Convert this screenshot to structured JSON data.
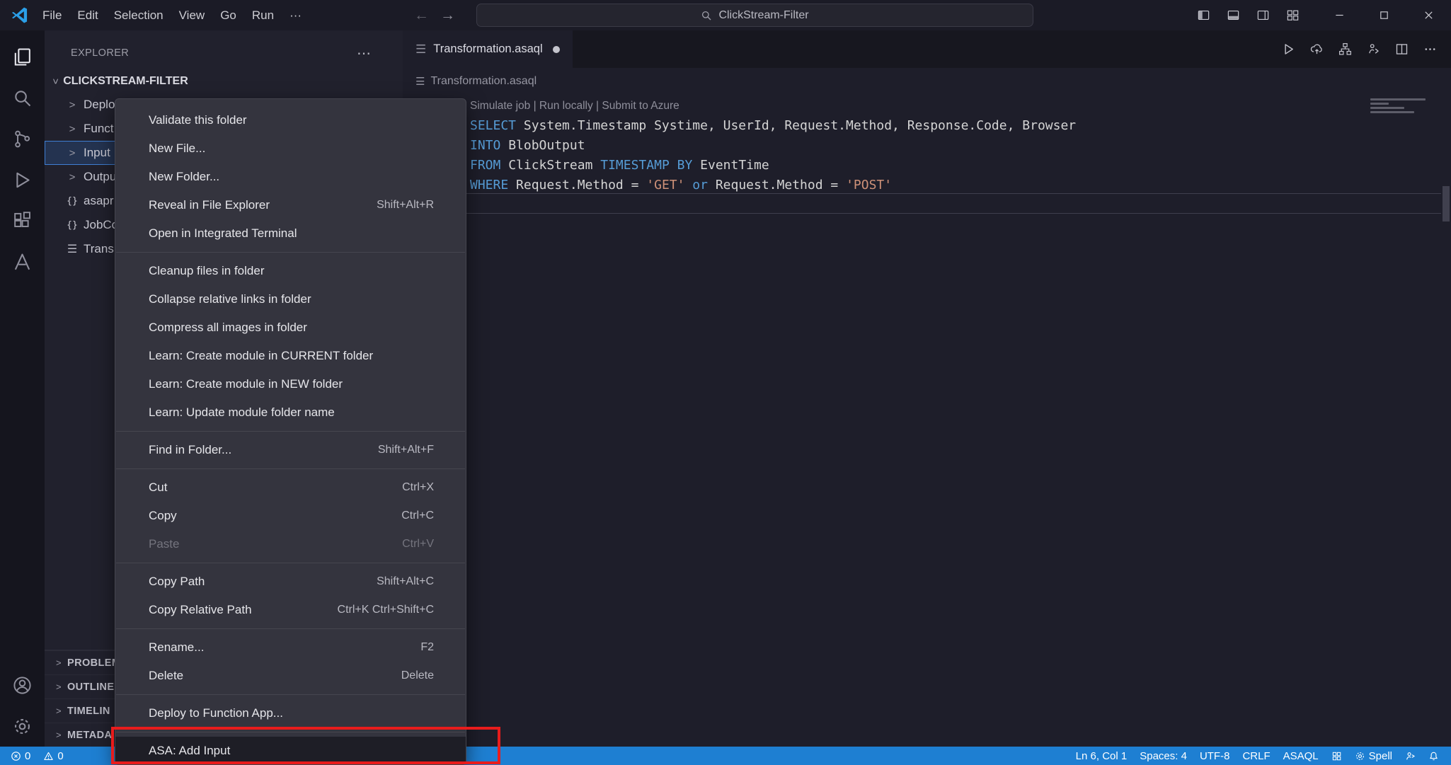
{
  "colors": {
    "statusbar_bg": "#1e7fd2",
    "annotation": "#e81c1c",
    "keyword": "#569cd6",
    "string": "#ce9178",
    "plain": "#d4d4d4",
    "codelens": "#8f8f9b"
  },
  "title_bar": {
    "menus": [
      "File",
      "Edit",
      "Selection",
      "View",
      "Go",
      "Run",
      "···"
    ],
    "search_text": "ClickStream-Filter"
  },
  "explorer": {
    "title": "EXPLORER",
    "root_label": "CLICKSTREAM-FILTER",
    "items": [
      {
        "label": "Deplo",
        "icon": "chevron",
        "selected": false
      },
      {
        "label": "Funct",
        "icon": "chevron",
        "selected": false
      },
      {
        "label": "Input",
        "icon": "chevron",
        "selected": true
      },
      {
        "label": "Outpu",
        "icon": "chevron",
        "selected": false
      },
      {
        "label": "asapr",
        "icon": "json",
        "selected": false
      },
      {
        "label": "JobCo",
        "icon": "json",
        "selected": false
      },
      {
        "label": "Trans",
        "icon": "file",
        "selected": false
      }
    ],
    "bottom_sections": [
      "PROBLEM",
      "OUTLINE",
      "TIMELIN",
      "METADA"
    ]
  },
  "context_menu": {
    "groups": [
      {
        "items": [
          {
            "label": "Validate this folder"
          },
          {
            "label": "New File..."
          },
          {
            "label": "New Folder..."
          },
          {
            "label": "Reveal in File Explorer",
            "shortcut": "Shift+Alt+R"
          },
          {
            "label": "Open in Integrated Terminal"
          }
        ]
      },
      {
        "items": [
          {
            "label": "Cleanup files in folder"
          },
          {
            "label": "Collapse relative links in folder"
          },
          {
            "label": "Compress all images in folder"
          },
          {
            "label": "Learn: Create module in CURRENT folder"
          },
          {
            "label": "Learn: Create module in NEW folder"
          },
          {
            "label": "Learn: Update module folder name"
          }
        ]
      },
      {
        "items": [
          {
            "label": "Find in Folder...",
            "shortcut": "Shift+Alt+F"
          }
        ]
      },
      {
        "items": [
          {
            "label": "Cut",
            "shortcut": "Ctrl+X"
          },
          {
            "label": "Copy",
            "shortcut": "Ctrl+C"
          },
          {
            "label": "Paste",
            "shortcut": "Ctrl+V",
            "disabled": true
          }
        ]
      },
      {
        "items": [
          {
            "label": "Copy Path",
            "shortcut": "Shift+Alt+C"
          },
          {
            "label": "Copy Relative Path",
            "shortcut": "Ctrl+K Ctrl+Shift+C"
          }
        ]
      },
      {
        "items": [
          {
            "label": "Rename...",
            "shortcut": "F2"
          },
          {
            "label": "Delete",
            "shortcut": "Delete"
          }
        ]
      },
      {
        "items": [
          {
            "label": "Deploy to Function App..."
          }
        ]
      },
      {
        "items": [
          {
            "label": "ASA: Add Input",
            "highlighted": true
          }
        ]
      }
    ]
  },
  "editor": {
    "tab_label": "Transformation.asaql",
    "tab_dirty": true,
    "breadcrumb": "Transformation.asaql",
    "code_lines": [
      {
        "type": "codelens",
        "tokens": [
          {
            "style": "lens",
            "text": "Simulate job | Run locally | Submit to Azure"
          }
        ]
      },
      {
        "type": "code",
        "tokens": [
          {
            "style": "kw",
            "text": "SELECT"
          },
          {
            "style": "plain",
            "text": " System.Timestamp Systime, UserId, Request.Method, Response.Code, Browser"
          }
        ]
      },
      {
        "type": "code",
        "tokens": [
          {
            "style": "kw",
            "text": "INTO"
          },
          {
            "style": "plain",
            "text": " BlobOutput"
          }
        ]
      },
      {
        "type": "code",
        "tokens": [
          {
            "style": "kw",
            "text": "FROM"
          },
          {
            "style": "plain",
            "text": " ClickStream "
          },
          {
            "style": "kw",
            "text": "TIMESTAMP"
          },
          {
            "style": "plain",
            "text": " "
          },
          {
            "style": "kw",
            "text": "BY"
          },
          {
            "style": "plain",
            "text": " EventTime"
          }
        ]
      },
      {
        "type": "code",
        "tokens": [
          {
            "style": "kw",
            "text": "WHERE"
          },
          {
            "style": "plain",
            "text": " Request.Method = "
          },
          {
            "style": "string",
            "text": "'GET'"
          },
          {
            "style": "plain",
            "text": " "
          },
          {
            "style": "kw",
            "text": "or"
          },
          {
            "style": "plain",
            "text": " Request.Method = "
          },
          {
            "style": "string",
            "text": "'POST'"
          }
        ]
      }
    ]
  },
  "status_bar": {
    "left": [
      {
        "name": "errors-count",
        "icon": "error-icon",
        "label": "0"
      },
      {
        "name": "warnings-count",
        "icon": "warning-icon",
        "label": "0"
      }
    ],
    "right": [
      {
        "name": "cursor-position",
        "label": "Ln 6, Col 1"
      },
      {
        "name": "indentation",
        "label": "Spaces: 4"
      },
      {
        "name": "encoding",
        "label": "UTF-8"
      },
      {
        "name": "eol-sequence",
        "label": "CRLF"
      },
      {
        "name": "language-mode",
        "label": "ASAQL"
      },
      {
        "name": "container-tools",
        "icon": "grid-icon",
        "label": ""
      },
      {
        "name": "spell-checker",
        "icon": "spell-gear-icon",
        "label": "Spell"
      },
      {
        "name": "feedback",
        "icon": "person-feedback-icon",
        "label": ""
      },
      {
        "name": "notifications",
        "icon": "bell-icon",
        "label": ""
      }
    ]
  }
}
